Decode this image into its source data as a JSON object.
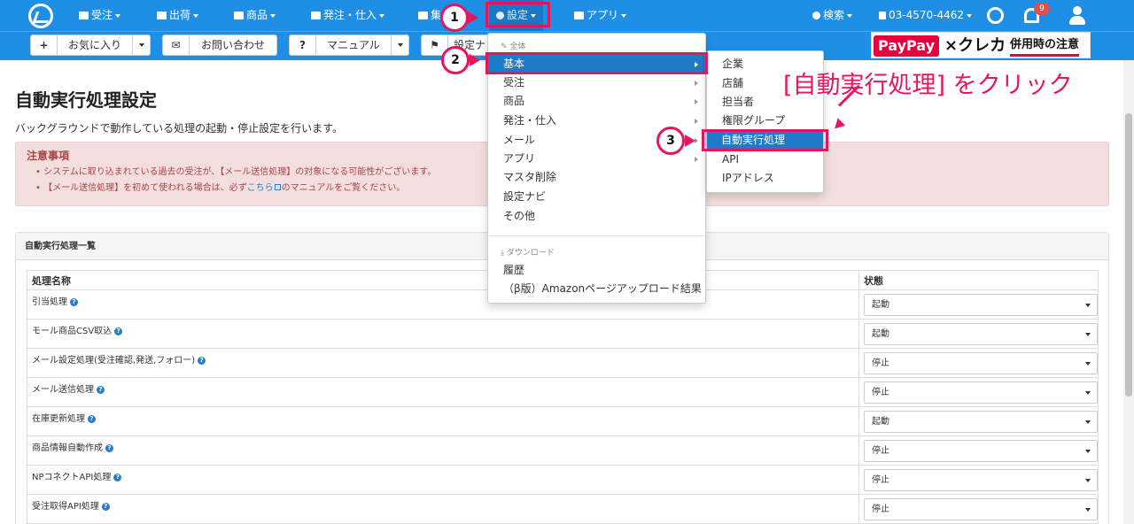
{
  "nav": {
    "items": [
      {
        "label": "受注"
      },
      {
        "label": "出荷"
      },
      {
        "label": "商品"
      },
      {
        "label": "発注・仕入"
      },
      {
        "label": "集"
      },
      {
        "label": "設定"
      },
      {
        "label": "アプリ"
      }
    ],
    "search": "検索",
    "phone": "03-4570-4462",
    "notifications": "9"
  },
  "toolbar": {
    "favorites": "お気に入り",
    "contact": "お問い合わせ",
    "manual": "マニュアル",
    "settings_navi": "設定ナ"
  },
  "banner": {
    "paypay": "PayPay",
    "kureka": "×クレカ",
    "note": "併用時の注意"
  },
  "page": {
    "title": "自動実行処理設定",
    "description": "バックグラウンドで動作している処理の起動・停止設定を行います。"
  },
  "alert": {
    "heading": "注意事項",
    "line1": "システムに取り込まれている過去の受注が、【メール送信処理】の対象になる可能性がございます。",
    "line2_pre": "【メール送信処理】を初めて使われる場合は、必ず",
    "line2_link": "こちら",
    "line2_post": "のマニュアルをご覧ください。"
  },
  "panel": {
    "title": "自動実行処理一覧",
    "columns": [
      "処理名称",
      "状態"
    ],
    "rows": [
      {
        "name": "引当処理",
        "status": "起動"
      },
      {
        "name": "モール商品CSV取込",
        "status": "起動"
      },
      {
        "name": "メール設定処理(受注確認,発送,フォロー)",
        "status": "停止"
      },
      {
        "name": "メール送信処理",
        "status": "停止"
      },
      {
        "name": "在庫更新処理",
        "status": "起動"
      },
      {
        "name": "商品情報自動作成",
        "status": "停止"
      },
      {
        "name": "NPコネクトAPI処理",
        "status": "停止"
      },
      {
        "name": "受注取得API処理",
        "status": "停止"
      }
    ]
  },
  "menu1": {
    "header_all": "全体",
    "items": [
      "基本",
      "受注",
      "商品",
      "発注・仕入",
      "メール",
      "アプリ",
      "マスタ削除",
      "設定ナビ",
      "その他"
    ],
    "header_download": "ダウンロード",
    "download_items": [
      "履歴",
      "（β版）Amazonページアップロード結果"
    ]
  },
  "menu2": {
    "items": [
      "企業",
      "店舗",
      "担当者",
      "権限グループ",
      "自動実行処理",
      "API",
      "IPアドレス"
    ]
  },
  "annotations": {
    "step1": "1",
    "step2": "2",
    "step3": "3",
    "callout": "[自動実行処理] をクリック",
    "color": "#e6155e"
  }
}
